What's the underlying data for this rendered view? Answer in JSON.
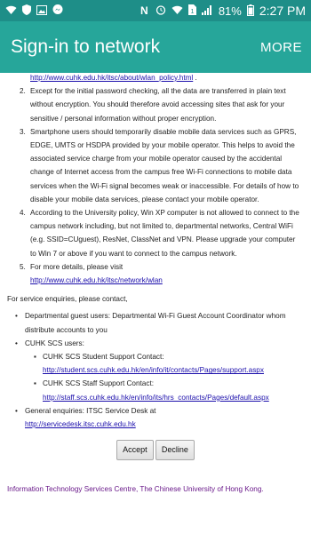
{
  "status_bar": {
    "battery": "81%",
    "time": "2:27 PM"
  },
  "app_bar": {
    "title": "Sign-in to network",
    "more_label": "MORE"
  },
  "policy": {
    "first_link": "http://www.cuhk.edu.hk/itsc/about/wlan_policy.html",
    "first_link_suffix": " .",
    "items": [
      {
        "num": "2.",
        "text": "Except for the initial password checking, all the data are transferred in plain text without encryption. You should therefore avoid accessing sites that ask for your sensitive / personal information without proper encryption."
      },
      {
        "num": "3.",
        "text": "Smartphone users should temporarily disable mobile data services such as GPRS, EDGE, UMTS or HSDPA provided by your mobile operator. This helps to avoid the associated service charge from your mobile operator caused by the accidental change of Internet access from the campus free Wi-Fi connections to mobile data services when the Wi-Fi signal becomes weak or inaccessible. For details of how to disable your mobile data services, please contact your mobile operator."
      },
      {
        "num": "4.",
        "text": "According to the University policy, Win XP computer is not allowed to connect to the campus network including, but not limited to, departmental networks, Central WiFi (e.g. SSID=CUguest), ResNet, ClassNet and VPN. Please upgrade your computer to Win 7 or above if you want to connect to the campus network."
      },
      {
        "num": "5.",
        "text": "For more details, please visit",
        "link": "http://www.cuhk.edu.hk/itsc/network/wlan"
      }
    ]
  },
  "enquiries": {
    "intro": "For service enquiries, please contact,",
    "departmental": "Departmental guest users: Departmental Wi-Fi Guest Account Coordinator whom distribute accounts to you",
    "scs_label": "CUHK SCS users:",
    "student_label": "CUHK SCS Student Support Contact:",
    "student_link": "http://student.scs.cuhk.edu.hk/en/info/it/contacts/Pages/support.aspx",
    "staff_label": "CUHK SCS Staff Support Contact:",
    "staff_link": "http://staff.scs.cuhk.edu.hk/en/info/its/hrs_contacts/Pages/default.aspx",
    "general_label": "General enquiries: ITSC Service Desk at",
    "general_link": "http://servicedesk.itsc.cuhk.edu.hk"
  },
  "buttons": {
    "accept": "Accept",
    "decline": "Decline"
  },
  "footer": {
    "text": "Information Technology Services Centre, The Chinese University of Hong Kong."
  }
}
